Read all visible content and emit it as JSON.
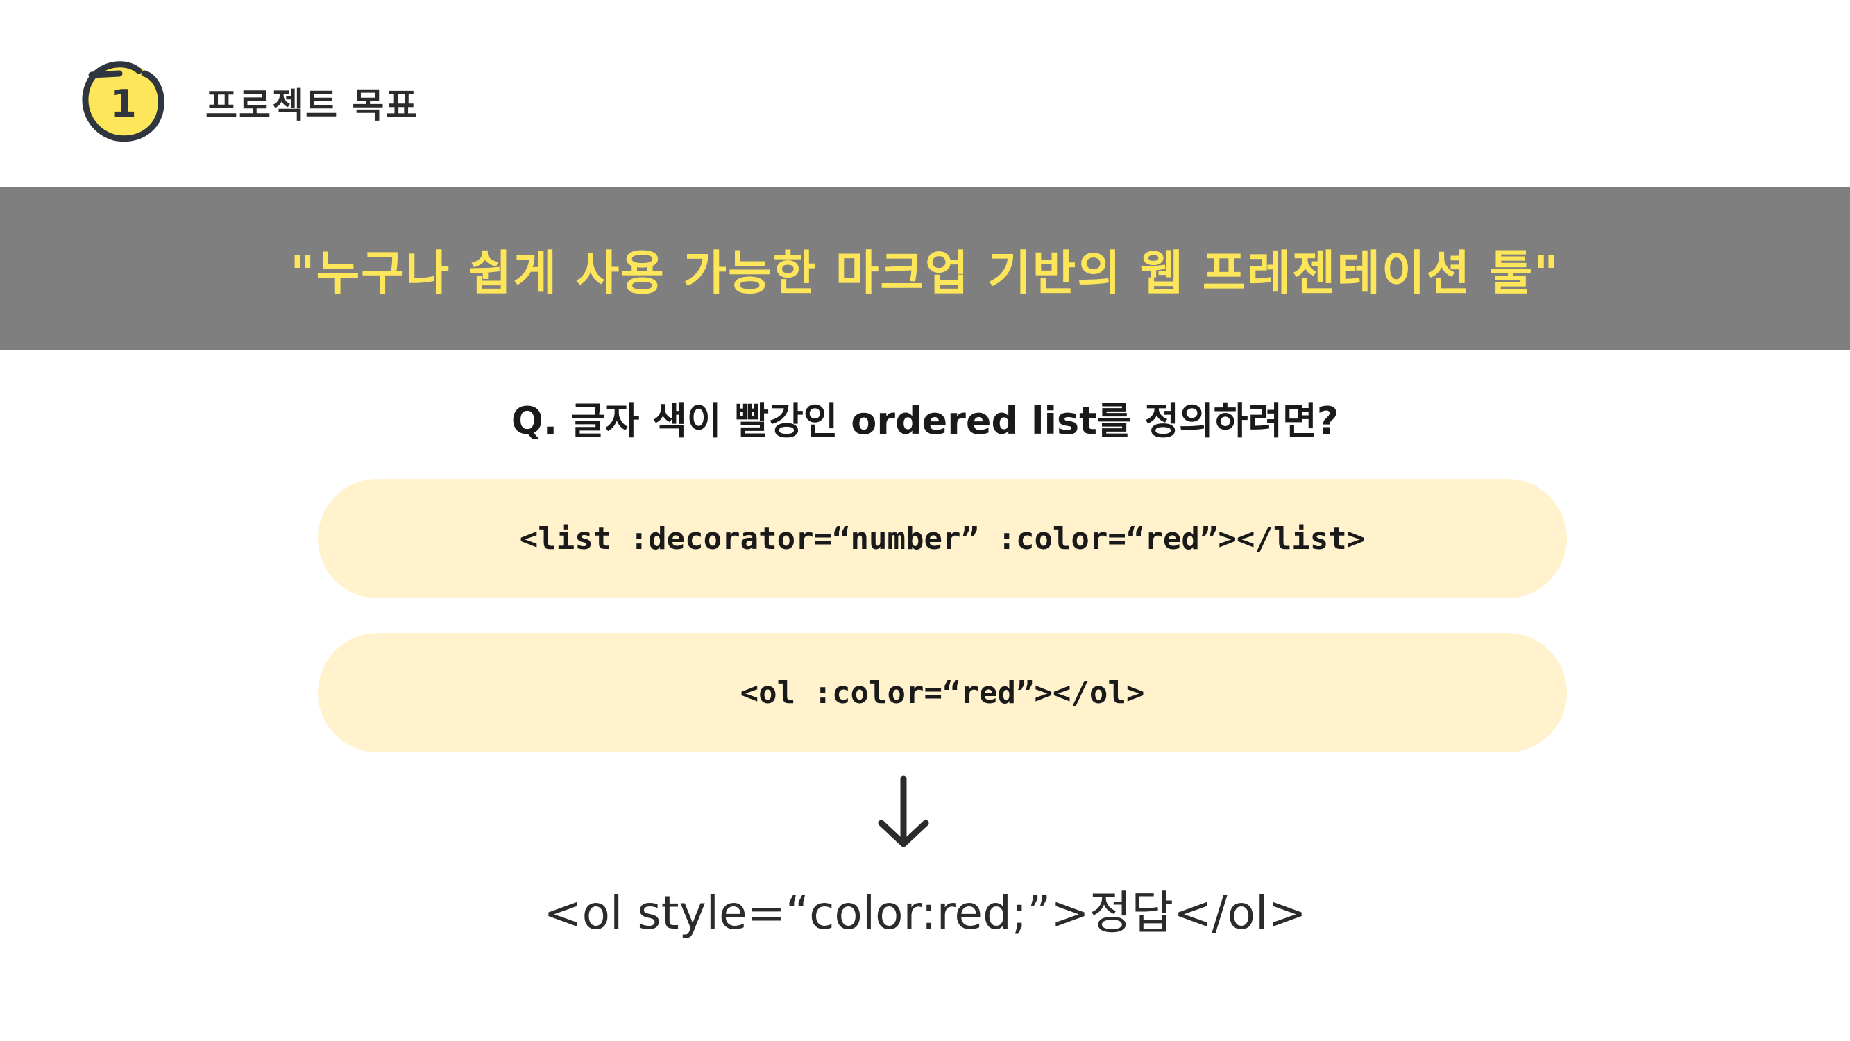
{
  "header": {
    "badge_number": "1",
    "badge_icon": "numbered-circle-badge",
    "section_title": "프로젝트 목표"
  },
  "banner": {
    "text": "\"누구나 쉽게 사용 가능한 마크업 기반의 웹 프레젠테이션 툴\""
  },
  "question": {
    "text": "Q. 글자 색이 빨강인 ordered list를 정의하려면?"
  },
  "options": [
    {
      "code": "<list :decorator=“number” :color=“red”></list>"
    },
    {
      "code": "<ol :color=“red”></ol>"
    }
  ],
  "arrow_icon": "arrow-down-icon",
  "answer": {
    "text": "<ol style=“color:red;”>정답</ol>"
  },
  "colors": {
    "banner_bg": "#7f7f7f",
    "banner_text": "#fde65a",
    "option_bg": "#fff2cc",
    "badge_fill": "#fde65a",
    "badge_stroke": "#2f3640"
  }
}
